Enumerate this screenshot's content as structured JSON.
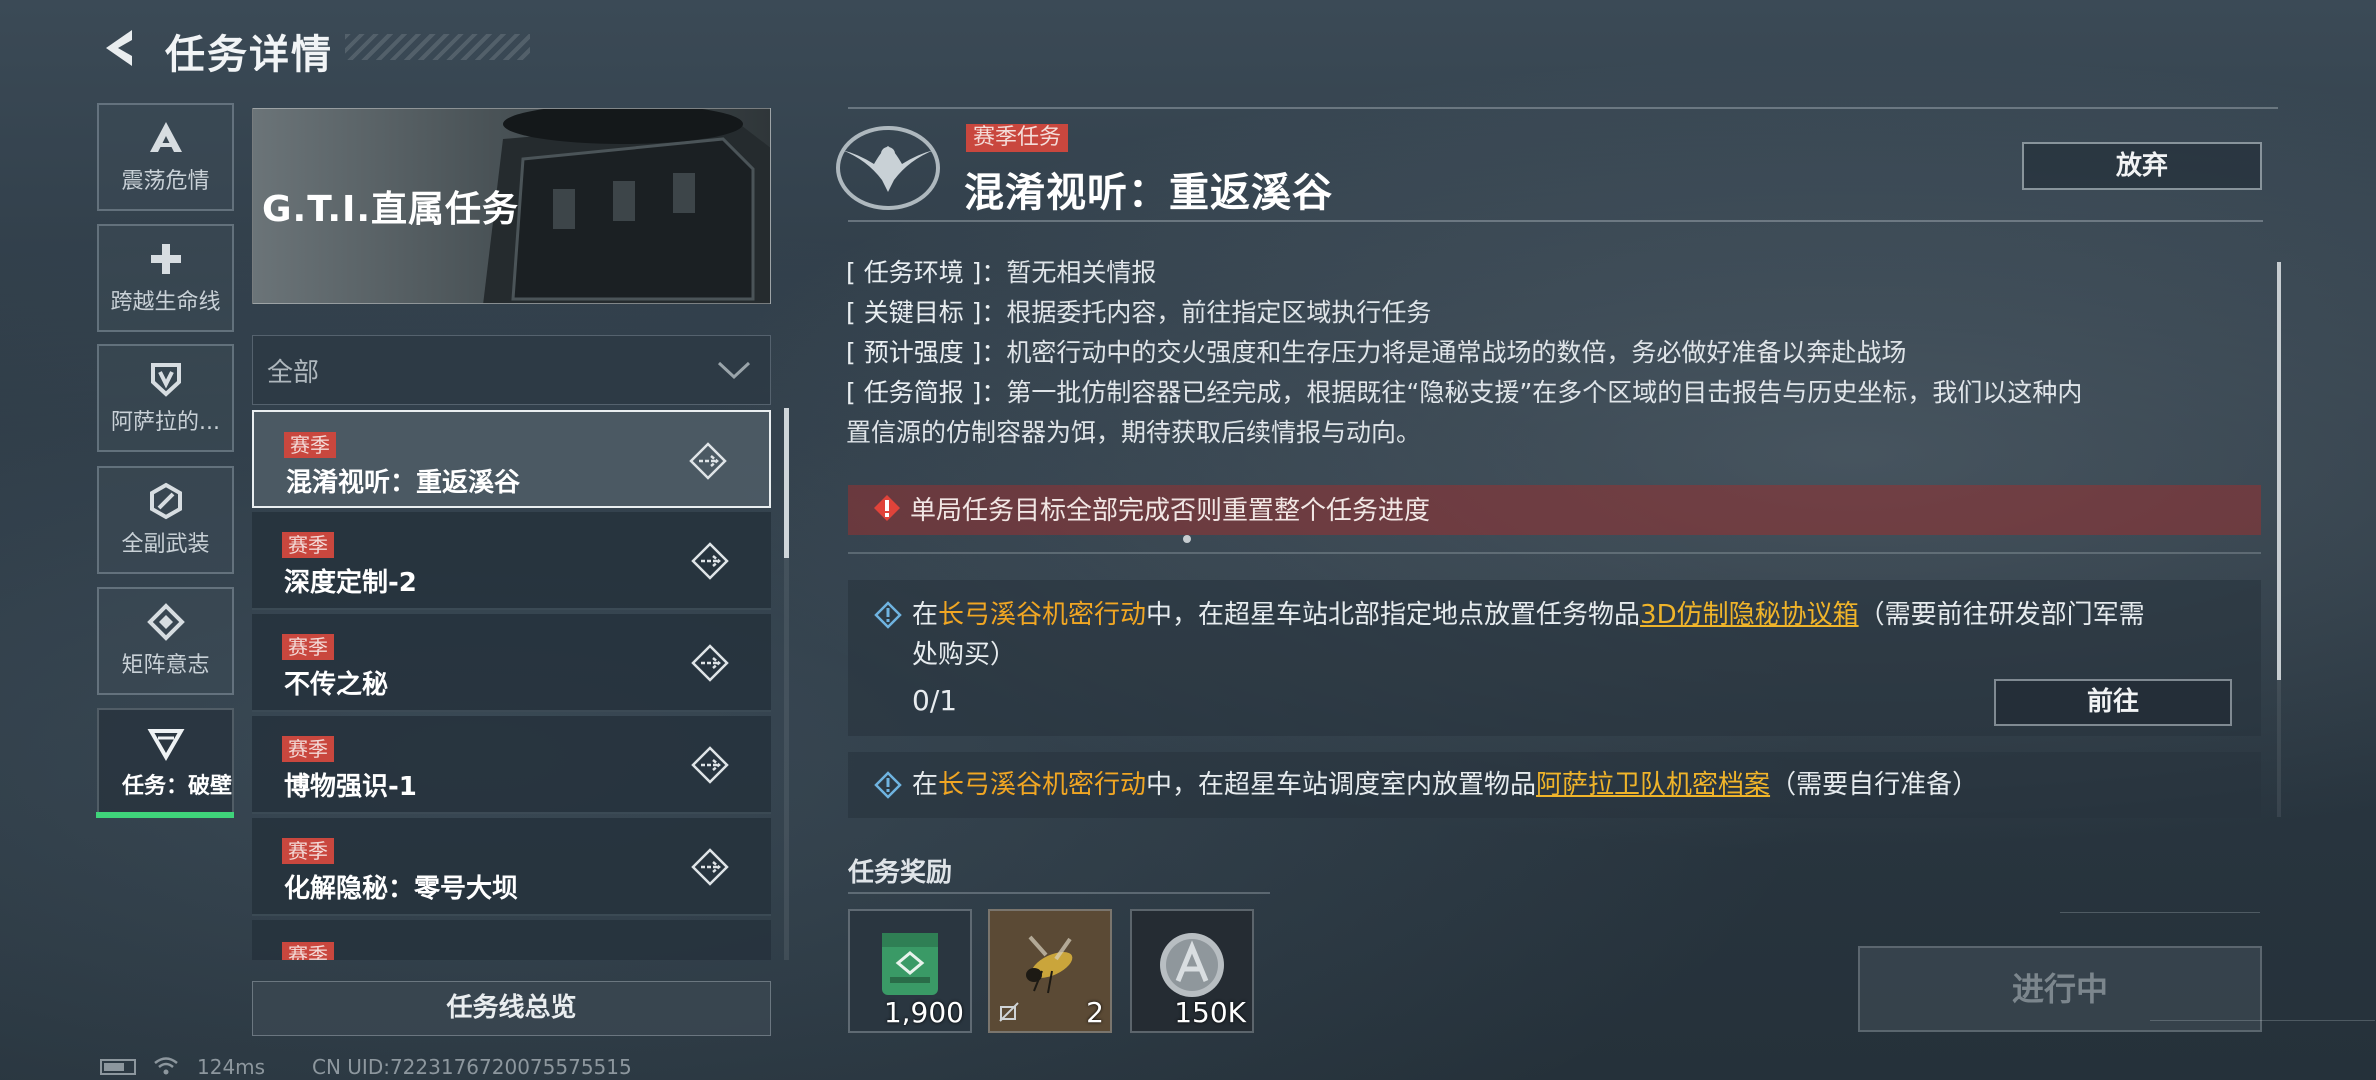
{
  "header": {
    "title": "任务详情"
  },
  "categories": [
    {
      "label": "震荡危情",
      "icon": "triangle-a-icon"
    },
    {
      "label": "跨越生命线",
      "icon": "cross-icon"
    },
    {
      "label": "阿萨拉的...",
      "icon": "shield-icon"
    },
    {
      "label": "全副武装",
      "icon": "hex-ring-icon"
    },
    {
      "label": "矩阵意志",
      "icon": "diamond-icon"
    },
    {
      "label": "任务：破壁",
      "icon": "down-triangle-icon",
      "active": true
    }
  ],
  "banner": {
    "title": "G.T.I.直属任务"
  },
  "filter": {
    "selected": "全部"
  },
  "tasks": [
    {
      "tag": "赛季",
      "name": "混淆视听：重返溪谷",
      "selected": true
    },
    {
      "tag": "赛季",
      "name": "深度定制-2"
    },
    {
      "tag": "赛季",
      "name": "不传之秘"
    },
    {
      "tag": "赛季",
      "name": "博物强识-1"
    },
    {
      "tag": "赛季",
      "name": "化解隐秘：零号大坝"
    },
    {
      "tag": "赛季",
      "name": ""
    }
  ],
  "overview_button": "任务线总览",
  "status_bar": {
    "ping": "124ms",
    "uid": "CN UID:72231767200755755​15"
  },
  "detail": {
    "season_tag": "赛季任务",
    "title": "混淆视听：重返溪谷",
    "abandon_label": "放弃",
    "info": [
      {
        "key": "[ 任务环境 ]：",
        "value": "暂无相关情报"
      },
      {
        "key": "[ 关键目标 ]：",
        "value": "根据委托内容，前往指定区域执行任务"
      },
      {
        "key": "[ 预计强度 ]：",
        "value": "机密行动中的交火强度和生存压力将是通常战场的数倍，务必做好准备以奔赴战场"
      },
      {
        "key": "[ 任务简报 ]：",
        "value": "第一批仿制容器已经完成，根据既往“隐秘支援”在多个区域的目击报告与历史坐标，我们以这种内"
      },
      {
        "key": "",
        "value": "置信源的仿制容器为饵，期待获取后续情报与动向。"
      }
    ],
    "warning": "单局任务目标全部完成否则重置整个任务进度",
    "objectives": [
      {
        "pre": "在",
        "op": "长弓溪谷机密行动",
        "mid": "中，在超星车站北部指定地点放置任务物品",
        "item": "3D仿制隐秘协议箱",
        "post": "（需要前往研发部门军需",
        "line2": "处购买）",
        "progress": "0/1",
        "go_label": "前往"
      },
      {
        "pre": "在",
        "op": "长弓溪谷机密行动",
        "mid": "中，在超星车站调度室内放置物品",
        "item": "阿萨拉卫队机密档案",
        "post": "（需要自行准备）"
      }
    ],
    "rewards_label": "任务奖励",
    "rewards": [
      {
        "icon": "green-case-icon",
        "count": "1,900"
      },
      {
        "icon": "wasp-icon",
        "count": "2"
      },
      {
        "icon": "silver-coin-icon",
        "count": "150K"
      }
    ],
    "status_button": "进行中"
  },
  "colors": {
    "accent_green": "#3fd47a",
    "season_red": "#c9473e",
    "highlight_orange": "#f1a623"
  }
}
